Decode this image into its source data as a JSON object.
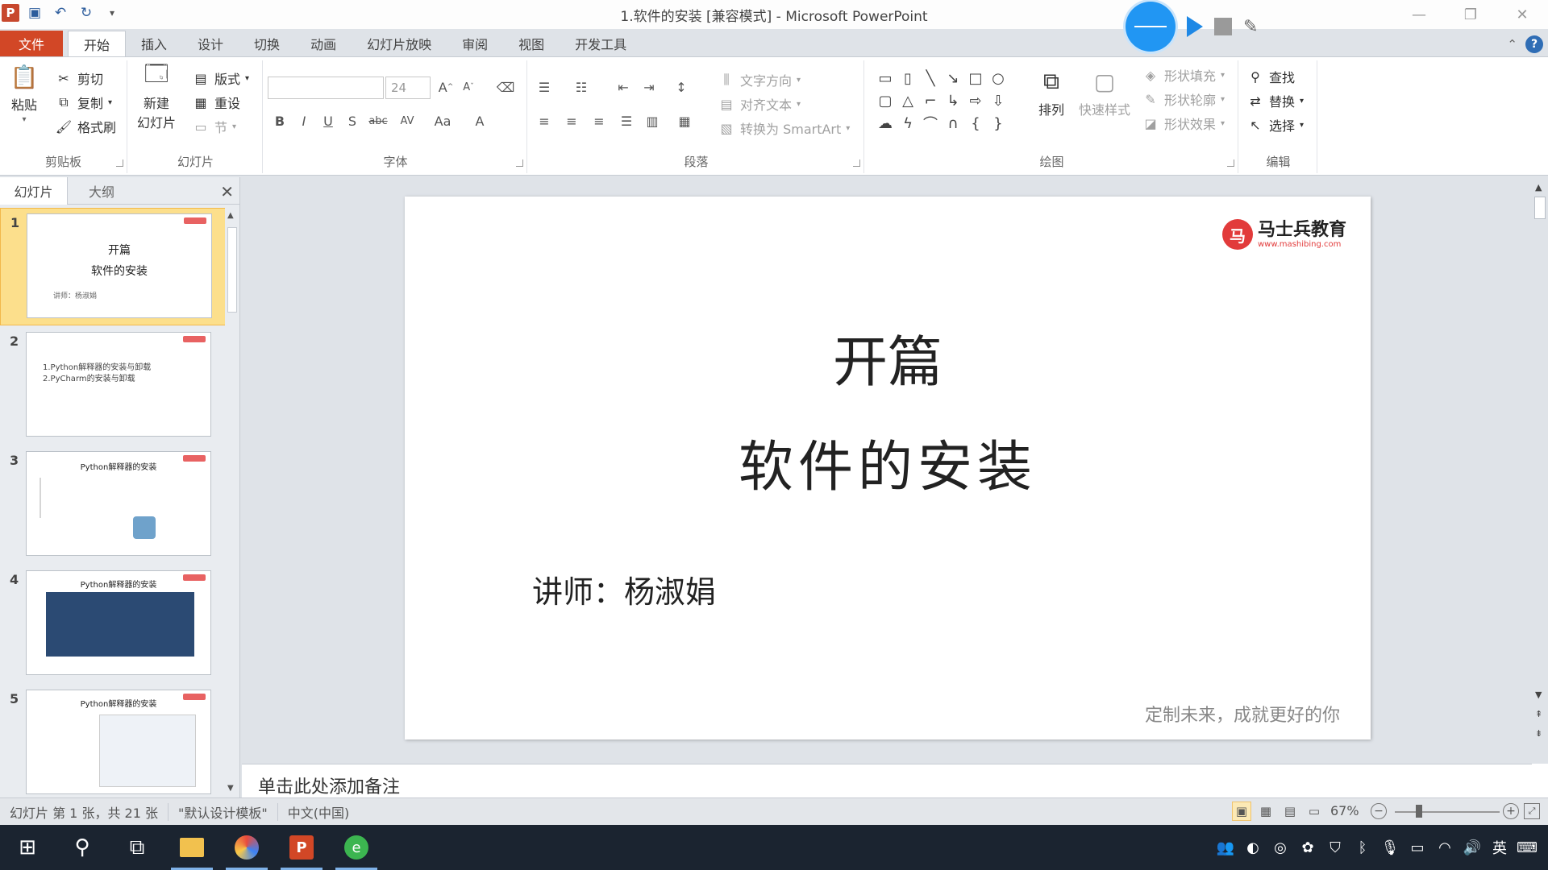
{
  "window": {
    "title": "1.软件的安装 [兼容模式] - Microsoft PowerPoint",
    "app_logo": "P",
    "controls": {
      "minimize": "—",
      "restore": "❐",
      "close": "✕"
    }
  },
  "ribbon_tabs": [
    {
      "label": "文件",
      "active": false
    },
    {
      "label": "开始",
      "active": true
    },
    {
      "label": "插入",
      "active": false
    },
    {
      "label": "设计",
      "active": false
    },
    {
      "label": "切换",
      "active": false
    },
    {
      "label": "动画",
      "active": false
    },
    {
      "label": "幻灯片放映",
      "active": false
    },
    {
      "label": "审阅",
      "active": false
    },
    {
      "label": "视图",
      "active": false
    },
    {
      "label": "开发工具",
      "active": false
    }
  ],
  "ribbon": {
    "clipboard": {
      "label": "剪贴板",
      "paste": "粘贴",
      "cut": "剪切",
      "copy": "复制",
      "format_painter": "格式刷"
    },
    "slides": {
      "label": "幻灯片",
      "new_slide_line1": "新建",
      "new_slide_line2": "幻灯片",
      "layout": "版式",
      "reset": "重设",
      "section": "节"
    },
    "font": {
      "label": "字体",
      "font_name": "",
      "font_size": "24"
    },
    "paragraph": {
      "label": "段落",
      "text_direction": "文字方向",
      "align_text": "对齐文本",
      "convert_smartart": "转换为 SmartArt"
    },
    "drawing": {
      "label": "绘图",
      "arrange": "排列",
      "quick_styles": "快速样式",
      "shape_fill": "形状填充",
      "shape_outline": "形状轮廓",
      "shape_effects": "形状效果"
    },
    "editing": {
      "label": "编辑",
      "find": "查找",
      "replace": "替换",
      "select": "选择"
    }
  },
  "left_pane": {
    "tabs": [
      {
        "label": "幻灯片",
        "active": true
      },
      {
        "label": "大纲",
        "active": false
      }
    ],
    "thumbnails": [
      {
        "num": "1",
        "title": "开篇",
        "subtitle": "软件的安装",
        "small": "讲师：杨淑娟"
      },
      {
        "num": "2",
        "lines": [
          "1.Python解释器的安装与卸载",
          "2.PyCharm的安装与卸载"
        ]
      },
      {
        "num": "3",
        "title": "Python解释器的安装"
      },
      {
        "num": "4",
        "title": "Python解释器的安装"
      },
      {
        "num": "5",
        "title": "Python解释器的安装"
      }
    ]
  },
  "slide": {
    "title": "开篇",
    "subtitle": "软件的安装",
    "author": "讲师：杨淑娟",
    "footer": "定制未来，成就更好的你",
    "logo_name": "马士兵教育",
    "logo_url": "www.mashibing.com"
  },
  "notes_placeholder": "单击此处添加备注",
  "statusbar": {
    "slide_info": "幻灯片 第 1 张，共 21 张",
    "theme": "\"默认设计模板\"",
    "language": "中文(中国)",
    "zoom": "67%"
  },
  "taskbar": {
    "tray_lang": "英"
  },
  "colors": {
    "file_tab": "#d24726",
    "selected_thumb": "#fcdf8c",
    "logo_red": "#e23b3b",
    "recorder_blue": "#2196f3"
  }
}
